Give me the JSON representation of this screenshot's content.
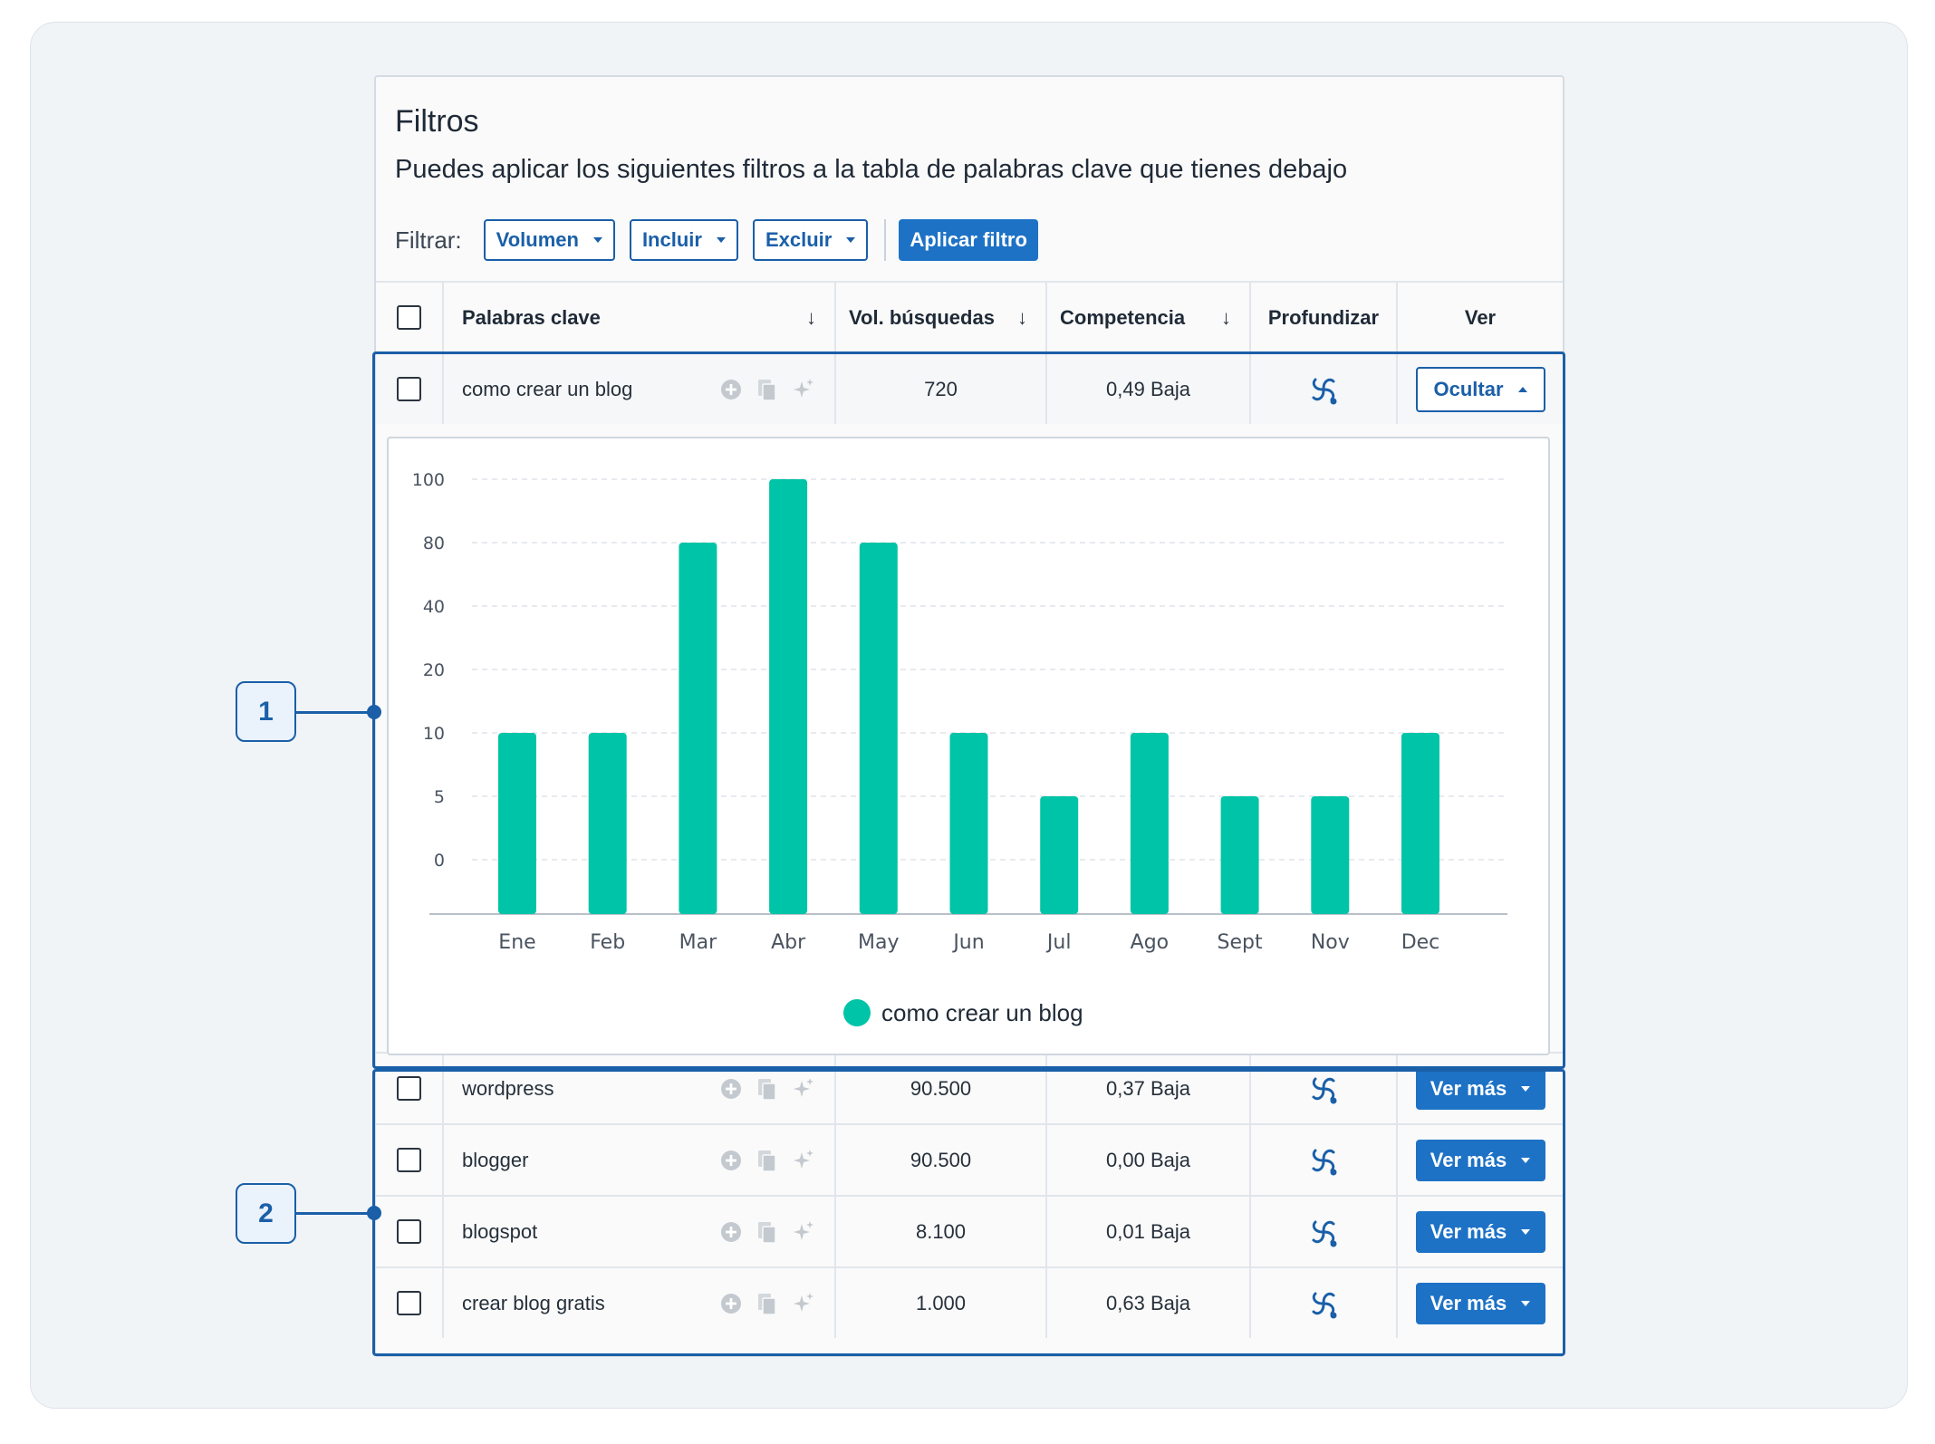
{
  "header": {
    "title": "Filtros",
    "subtitle": "Puedes aplicar los siguientes filtros a la tabla de palabras clave que tienes debajo"
  },
  "filters": {
    "label": "Filtrar:",
    "volume": "Volumen",
    "include": "Incluir",
    "exclude": "Excluir",
    "apply": "Aplicar filtro"
  },
  "table": {
    "columns": {
      "keywords": "Palabras clave",
      "volume": "Vol. búsquedas",
      "competition": "Competencia",
      "deepen": "Profundizar",
      "view": "Ver"
    },
    "sort_arrow": "↓",
    "expanded_row": {
      "keyword": "como crear un blog",
      "volume": "720",
      "competition": "0,49 Baja",
      "action": "Ocultar"
    },
    "rows": [
      {
        "keyword": "wordpress",
        "volume": "90.500",
        "competition": "0,37 Baja",
        "action": "Ver más"
      },
      {
        "keyword": "blogger",
        "volume": "90.500",
        "competition": "0,00 Baja",
        "action": "Ver más"
      },
      {
        "keyword": "blogspot",
        "volume": "8.100",
        "competition": "0,01 Baja",
        "action": "Ver más"
      },
      {
        "keyword": "crear blog gratis",
        "volume": "1.000",
        "competition": "0,63 Baja",
        "action": "Ver más"
      }
    ]
  },
  "chart_data": {
    "type": "bar",
    "categories": [
      "Ene",
      "Feb",
      "Mar",
      "Abr",
      "May",
      "Jun",
      "Jul",
      "Ago",
      "Sept",
      "Nov",
      "Dec"
    ],
    "y_ticks": [
      0,
      5,
      10,
      20,
      40,
      80,
      100
    ],
    "series": [
      {
        "name": "como crear un blog",
        "values": [
          10,
          10,
          80,
          100,
          80,
          10,
          5,
          10,
          5,
          5,
          10
        ],
        "color": "#00c4a7"
      }
    ],
    "grid": true,
    "legend": "bottom-center"
  },
  "callouts": [
    "1",
    "2"
  ],
  "icons": {
    "add": "plus-circle-icon",
    "copy": "copy-icon",
    "ideas": "sparkle-icon",
    "deepen": "swirl-icon"
  },
  "colors": {
    "accent": "#1d72c6",
    "accent_dark": "#1a5fa8",
    "bar": "#00c4a7"
  }
}
